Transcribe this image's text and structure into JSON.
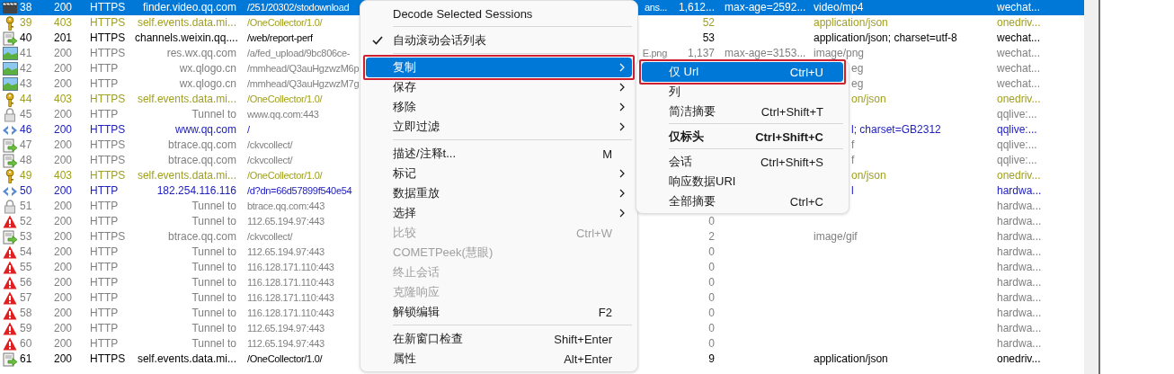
{
  "sessions": [
    {
      "kind": "video",
      "num": "38",
      "result": "200",
      "protocol": "HTTPS",
      "host": "finder.video.qq.com",
      "url": "/251/20302/stodownload",
      "url_end": "ans...",
      "body": "1,612...",
      "caching": "max-age=2592...",
      "content_type": "video/mp4",
      "process": "wechat...",
      "selected": true
    },
    {
      "kind": "blocked",
      "num": "39",
      "result": "403",
      "protocol": "HTTPS",
      "host": "self.events.data.mi...",
      "url": "/OneCollector/1.0/",
      "body": "52",
      "content_type": "application/json",
      "process": "onedriv...",
      "selected": false,
      "color": "#a0a020"
    },
    {
      "kind": "script",
      "num": "40",
      "result": "201",
      "protocol": "HTTPS",
      "host": "channels.weixin.qq....",
      "url": "/web/report-perf",
      "body": "53",
      "content_type": "application/json; charset=utf-8",
      "process": "wechat...",
      "selected": false,
      "color": "#000000"
    },
    {
      "kind": "image",
      "num": "41",
      "result": "200",
      "protocol": "HTTPS",
      "host": "res.wx.qq.com",
      "url": "/a/fed_upload/9bc806ce-",
      "url_end": "E.png",
      "body": "1,137",
      "caching": "max-age=3153...",
      "content_type": "image/png",
      "process": "wechat...",
      "selected": false,
      "color": "#808080"
    },
    {
      "kind": "image",
      "num": "42",
      "result": "200",
      "protocol": "HTTP",
      "host": "wx.qlogo.cn",
      "url": "/mmhead/Q3auHgzwzM6p",
      "content_type": "eg",
      "process": "wechat...",
      "selected": false,
      "color": "#808080"
    },
    {
      "kind": "image",
      "num": "43",
      "result": "200",
      "protocol": "HTTP",
      "host": "wx.qlogo.cn",
      "url": "/mmhead/Q3auHgzwzM7g",
      "content_type": "eg",
      "process": "wechat...",
      "selected": false,
      "color": "#808080"
    },
    {
      "kind": "blocked",
      "num": "44",
      "result": "403",
      "protocol": "HTTPS",
      "host": "self.events.data.mi...",
      "url": "/OneCollector/1.0/",
      "content_type": "on/json",
      "process": "onedriv...",
      "selected": false,
      "color": "#a0a020"
    },
    {
      "kind": "tunnel",
      "num": "45",
      "result": "200",
      "protocol": "HTTP",
      "host": "Tunnel to",
      "url": "www.qq.com:443",
      "process": "qqlive:...",
      "selected": false,
      "color": "#808080"
    },
    {
      "kind": "html",
      "num": "46",
      "result": "200",
      "protocol": "HTTPS",
      "host": "www.qq.com",
      "url": "/",
      "content_type": "l; charset=GB2312",
      "process": "qqlive:...",
      "selected": false,
      "color": "#2020c0"
    },
    {
      "kind": "script",
      "num": "47",
      "result": "200",
      "protocol": "HTTPS",
      "host": "btrace.qq.com",
      "url": "/ckvcollect/",
      "content_type": "f",
      "process": "qqlive:...",
      "selected": false,
      "color": "#808080"
    },
    {
      "kind": "script",
      "num": "48",
      "result": "200",
      "protocol": "HTTPS",
      "host": "btrace.qq.com",
      "url": "/ckvcollect/",
      "content_type": "f",
      "process": "qqlive:...",
      "selected": false,
      "color": "#808080"
    },
    {
      "kind": "blocked",
      "num": "49",
      "result": "403",
      "protocol": "HTTPS",
      "host": "self.events.data.mi...",
      "url": "/OneCollector/1.0/",
      "content_type": "on/json",
      "process": "onedriv...",
      "selected": false,
      "color": "#a0a020"
    },
    {
      "kind": "html",
      "num": "50",
      "result": "200",
      "protocol": "HTTP",
      "host": "182.254.116.116",
      "url": "/d?dn=66d57899f540e54",
      "content_type": "l",
      "process": "hardwa...",
      "selected": false,
      "color": "#2020c0"
    },
    {
      "kind": "tunnel",
      "num": "51",
      "result": "200",
      "protocol": "HTTP",
      "host": "Tunnel to",
      "url": "btrace.qq.com:443",
      "process": "hardwa...",
      "selected": false,
      "color": "#808080"
    },
    {
      "kind": "error",
      "num": "52",
      "result": "200",
      "protocol": "HTTP",
      "host": "Tunnel to",
      "url": "112.65.194.97:443",
      "body": "0",
      "process": "hardwa...",
      "selected": false,
      "color": "#808080"
    },
    {
      "kind": "script",
      "num": "53",
      "result": "200",
      "protocol": "HTTPS",
      "host": "btrace.qq.com",
      "url": "/ckvcollect/",
      "body": "2",
      "content_type": "image/gif",
      "process": "hardwa...",
      "selected": false,
      "color": "#808080"
    },
    {
      "kind": "error",
      "num": "54",
      "result": "200",
      "protocol": "HTTP",
      "host": "Tunnel to",
      "url": "112.65.194.97:443",
      "body": "0",
      "process": "hardwa...",
      "selected": false,
      "color": "#808080"
    },
    {
      "kind": "error",
      "num": "55",
      "result": "200",
      "protocol": "HTTP",
      "host": "Tunnel to",
      "url": "116.128.171.110:443",
      "body": "0",
      "process": "hardwa...",
      "selected": false,
      "color": "#808080"
    },
    {
      "kind": "error",
      "num": "56",
      "result": "200",
      "protocol": "HTTP",
      "host": "Tunnel to",
      "url": "116.128.171.110:443",
      "body": "0",
      "process": "hardwa...",
      "selected": false,
      "color": "#808080"
    },
    {
      "kind": "error",
      "num": "57",
      "result": "200",
      "protocol": "HTTP",
      "host": "Tunnel to",
      "url": "116.128.171.110:443",
      "body": "0",
      "process": "hardwa...",
      "selected": false,
      "color": "#808080"
    },
    {
      "kind": "error",
      "num": "58",
      "result": "200",
      "protocol": "HTTP",
      "host": "Tunnel to",
      "url": "116.128.171.110:443",
      "body": "0",
      "process": "hardwa...",
      "selected": false,
      "color": "#808080"
    },
    {
      "kind": "error",
      "num": "59",
      "result": "200",
      "protocol": "HTTP",
      "host": "Tunnel to",
      "url": "112.65.194.97:443",
      "body": "0",
      "process": "hardwa...",
      "selected": false,
      "color": "#808080"
    },
    {
      "kind": "error",
      "num": "60",
      "result": "200",
      "protocol": "HTTP",
      "host": "Tunnel to",
      "url": "112.65.194.97:443",
      "body": "0",
      "process": "hardwa...",
      "selected": false,
      "color": "#808080"
    },
    {
      "kind": "script",
      "num": "61",
      "result": "200",
      "protocol": "HTTPS",
      "host": "self.events.data.mi...",
      "url": "/OneCollector/1.0/",
      "body": "9",
      "content_type": "application/json",
      "process": "onedriv...",
      "selected": false,
      "color": "#000000"
    }
  ],
  "context_menu": {
    "items": [
      {
        "kind": "item",
        "label": "Decode Selected Sessions",
        "checked": false,
        "selected": false,
        "disabled": false,
        "has_submenu": false,
        "outlined": false
      },
      {
        "kind": "separator"
      },
      {
        "kind": "item",
        "label": "自动滚动会话列表",
        "checked": true,
        "selected": false,
        "disabled": false,
        "has_submenu": false,
        "outlined": false
      },
      {
        "kind": "separator"
      },
      {
        "kind": "item",
        "label": "复制",
        "checked": false,
        "selected": true,
        "disabled": false,
        "has_submenu": true,
        "outlined": true
      },
      {
        "kind": "item",
        "label": "保存",
        "checked": false,
        "selected": false,
        "disabled": false,
        "has_submenu": true,
        "outlined": false
      },
      {
        "kind": "item",
        "label": "移除",
        "checked": false,
        "selected": false,
        "disabled": false,
        "has_submenu": true,
        "outlined": false
      },
      {
        "kind": "item",
        "label": "立即过滤",
        "checked": false,
        "selected": false,
        "disabled": false,
        "has_submenu": true,
        "outlined": false
      },
      {
        "kind": "separator"
      },
      {
        "kind": "item",
        "label": "描述/注释t...",
        "shortcut": "M",
        "checked": false,
        "selected": false,
        "disabled": false,
        "has_submenu": false,
        "outlined": false
      },
      {
        "kind": "item",
        "label": "标记",
        "checked": false,
        "selected": false,
        "disabled": false,
        "has_submenu": true,
        "outlined": false
      },
      {
        "kind": "item",
        "label": "数据重放",
        "checked": false,
        "selected": false,
        "disabled": false,
        "has_submenu": true,
        "outlined": false
      },
      {
        "kind": "item",
        "label": "选择",
        "checked": false,
        "selected": false,
        "disabled": false,
        "has_submenu": true,
        "outlined": false
      },
      {
        "kind": "item",
        "label": "比较",
        "shortcut": "Ctrl+W",
        "checked": false,
        "selected": false,
        "disabled": true,
        "has_submenu": false,
        "outlined": false
      },
      {
        "kind": "item",
        "label": "COMETPeek(慧眼)",
        "checked": false,
        "selected": false,
        "disabled": true,
        "has_submenu": false,
        "outlined": false
      },
      {
        "kind": "item",
        "label": "终止会话",
        "checked": false,
        "selected": false,
        "disabled": true,
        "has_submenu": false,
        "outlined": false
      },
      {
        "kind": "item",
        "label": "克隆响应",
        "checked": false,
        "selected": false,
        "disabled": true,
        "has_submenu": false,
        "outlined": false
      },
      {
        "kind": "item",
        "label": "解锁编辑",
        "shortcut": "F2",
        "checked": false,
        "selected": false,
        "disabled": false,
        "has_submenu": false,
        "outlined": false
      },
      {
        "kind": "separator"
      },
      {
        "kind": "item",
        "label": "在新窗口检查",
        "shortcut": "Shift+Enter",
        "checked": false,
        "selected": false,
        "disabled": false,
        "has_submenu": false,
        "outlined": false
      },
      {
        "kind": "item",
        "label": "属性",
        "shortcut": "Alt+Enter",
        "checked": false,
        "selected": false,
        "disabled": false,
        "has_submenu": false,
        "outlined": false
      }
    ]
  },
  "copy_submenu": {
    "items": [
      {
        "kind": "item",
        "label": "仅 Url",
        "shortcut": "Ctrl+U",
        "selected": true,
        "bold": false,
        "outlined": true
      },
      {
        "kind": "item",
        "label": "列",
        "selected": false,
        "bold": false,
        "outlined": false
      },
      {
        "kind": "item",
        "label": "简洁摘要",
        "shortcut": "Ctrl+Shift+T",
        "selected": false,
        "bold": false,
        "outlined": false
      },
      {
        "kind": "separator"
      },
      {
        "kind": "item",
        "label": "仅标头",
        "shortcut": "Ctrl+Shift+C",
        "selected": false,
        "bold": true,
        "outlined": false
      },
      {
        "kind": "separator"
      },
      {
        "kind": "item",
        "label": "会话",
        "shortcut": "Ctrl+Shift+S",
        "selected": false,
        "bold": false,
        "outlined": false
      },
      {
        "kind": "item",
        "label": "响应数据URI",
        "selected": false,
        "bold": false,
        "outlined": false
      },
      {
        "kind": "item",
        "label": "全部摘要",
        "shortcut": "Ctrl+C",
        "selected": false,
        "bold": false,
        "outlined": false
      }
    ]
  }
}
